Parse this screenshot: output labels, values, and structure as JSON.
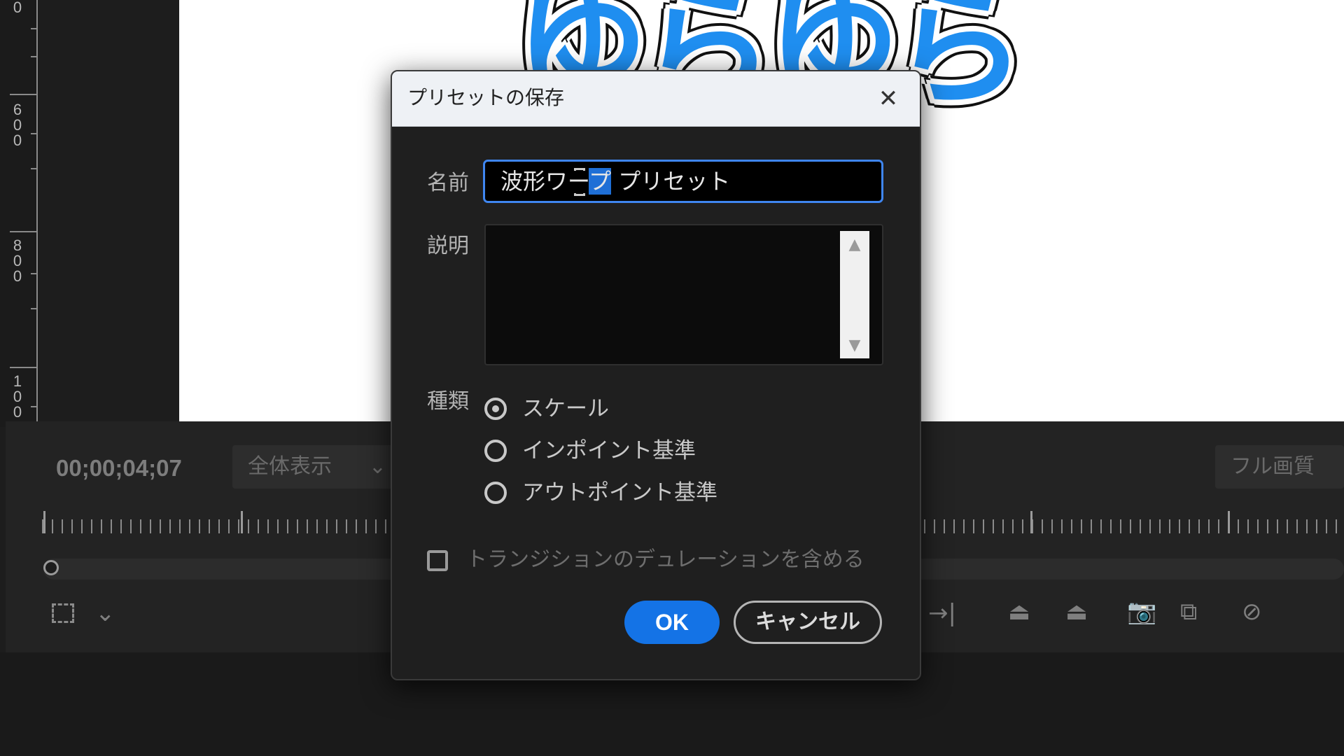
{
  "ruler": {
    "labels": [
      "0",
      "600",
      "800",
      "100"
    ]
  },
  "canvas": {
    "title_graphic_text": "ゆらゆら"
  },
  "monitor": {
    "timecode": "00;00;04;07",
    "zoom_dropdown": "全体表示",
    "quality_dropdown": "フル画質"
  },
  "dialog": {
    "title": "プリセットの保存",
    "close_glyph": "✕",
    "name_label": "名前",
    "name_value_before": "波形ワー",
    "name_value_selected": "プ",
    "name_value_after": " プリセット",
    "description_label": "説明",
    "description_value": "",
    "type_label": "種類",
    "type_options": [
      {
        "label": "スケール",
        "checked": true
      },
      {
        "label": "インポイント基準",
        "checked": false
      },
      {
        "label": "アウトポイント基準",
        "checked": false
      }
    ],
    "checkbox_label": "トランジションのデュレーションを含める",
    "checkbox_checked": false,
    "ok_label": "OK",
    "cancel_label": "キャンセル",
    "colors": {
      "accent": "#1473e6",
      "selection": "#1f6fd6",
      "focus_border": "#3f86f0"
    }
  }
}
